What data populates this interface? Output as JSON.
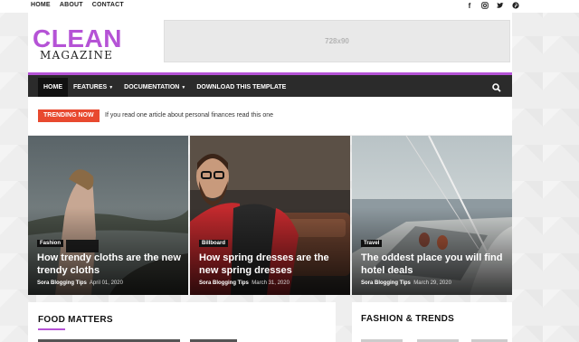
{
  "topbar": {
    "links": [
      "HOME",
      "ABOUT",
      "CONTACT"
    ],
    "social_icons": [
      "facebook-icon",
      "instagram-icon",
      "twitter-icon",
      "pinterest-icon"
    ]
  },
  "header": {
    "logo_main": "CLEAN",
    "logo_sub": "MAGAZINE",
    "ad_label": "728x90"
  },
  "nav": {
    "items": [
      {
        "label": "HOME",
        "active": true
      },
      {
        "label": "FEATURES",
        "dropdown": true
      },
      {
        "label": "DOCUMENTATION",
        "dropdown": true
      },
      {
        "label": "DOWNLOAD THIS TEMPLATE"
      }
    ],
    "search_icon": "search-icon",
    "accent": "#b553d6"
  },
  "trending": {
    "badge": "TRENDING NOW",
    "text": "If you read one article about personal finances read this one",
    "badge_color": "#e8492f"
  },
  "featured": [
    {
      "tag": "Fashion",
      "title": "How trendy cloths are the new trendy cloths",
      "author": "Sora Blogging Tips",
      "date": "April 01, 2020"
    },
    {
      "tag": "Billboard",
      "title": "How spring dresses are the new spring dresses",
      "author": "Sora Blogging Tips",
      "date": "March 31, 2020"
    },
    {
      "tag": "Travel",
      "title": "The oddest place you will find hotel deals",
      "author": "Sora Blogging Tips",
      "date": "March 29, 2020"
    }
  ],
  "sections": {
    "left_title": "FOOD MATTERS",
    "right_title": "FASHION & TRENDS"
  }
}
